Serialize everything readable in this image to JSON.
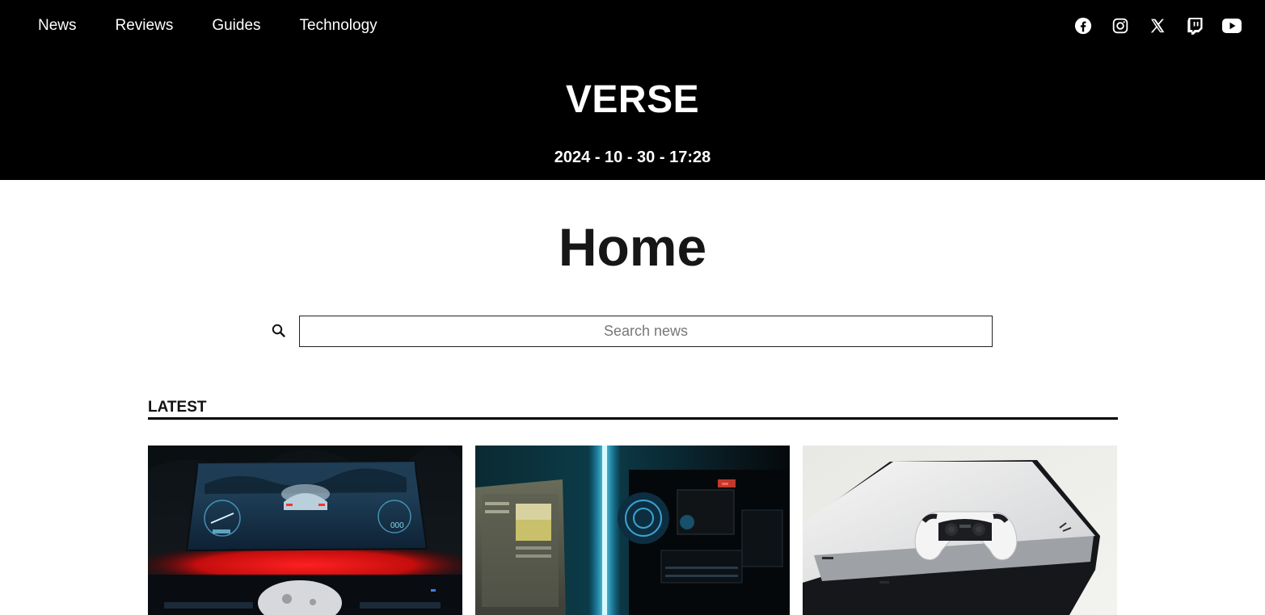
{
  "nav": {
    "items": [
      {
        "label": "News"
      },
      {
        "label": "Reviews"
      },
      {
        "label": "Guides"
      },
      {
        "label": "Technology"
      }
    ]
  },
  "social": {
    "icons": [
      "facebook-icon",
      "instagram-icon",
      "x-icon",
      "twitch-icon",
      "youtube-icon"
    ]
  },
  "header": {
    "brand": "VERSE",
    "datetime": "2024 - 10 - 30 - 17:28",
    "background": "#000000"
  },
  "main": {
    "title": "Home",
    "search": {
      "placeholder": "Search news",
      "value": ""
    },
    "latest": {
      "heading": "LATEST",
      "cards": [
        {
          "image": "racing-game-setup-image"
        },
        {
          "image": "pc-build-image"
        },
        {
          "image": "ps5-console-image"
        }
      ]
    }
  }
}
